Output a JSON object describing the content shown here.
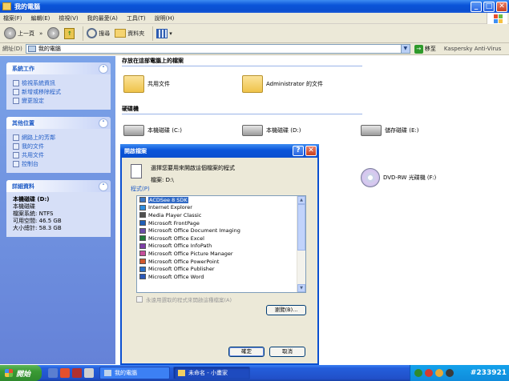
{
  "window": {
    "title": "我的電腦",
    "controls": {
      "minimize": "_",
      "maximize": "□",
      "close": "✕"
    }
  },
  "menubar": {
    "items": [
      "檔案(F)",
      "編輯(E)",
      "檢視(V)",
      "我的最愛(A)",
      "工具(T)",
      "說明(H)"
    ]
  },
  "toolbar": {
    "back": "上一頁",
    "forward": "»",
    "search": "搜尋",
    "folders": "資料夾",
    "views_arrow": "▾"
  },
  "addressbar": {
    "label": "網址(D)",
    "value": "我的電腦",
    "go_label": "移至",
    "links_label": "Kaspersky Anti-Virus"
  },
  "taskpane": {
    "system_tasks": {
      "title": "系統工作",
      "items": [
        "檢視系統資訊",
        "新增或移除程式",
        "變更設定"
      ]
    },
    "other_places": {
      "title": "其他位置",
      "items": [
        "網路上的芳鄰",
        "我的文件",
        "共用文件",
        "控制台"
      ]
    },
    "details": {
      "title": "詳細資料",
      "name": "本機磁碟 (D:)",
      "type": "本機磁碟",
      "fs": "檔案系統: NTFS",
      "free": "可用空間: 46.5 GB",
      "total": "大小總計: 58.3 GB"
    },
    "collapse_glyph": "˄"
  },
  "content": {
    "stored_files_header": "存放在這部電腦上的檔案",
    "folders": [
      "共用文件",
      "Administrator 的文件"
    ],
    "drives_header": "硬碟機",
    "drives": [
      "本機磁碟 (C:)",
      "本機磁碟 (D:)",
      "儲存磁碟 (E:)"
    ],
    "removable": [
      "DVD-RW 光碟機 (F:)"
    ]
  },
  "dialog": {
    "title": "開啟檔案",
    "help": "?",
    "close": "✕",
    "prompt": "選擇您要用來開啟這個檔案的程式",
    "file_label": "檔案:   D:\\",
    "programs_label": "程式(P)",
    "programs": [
      {
        "name": "ACDSee 8 SDK",
        "color": "#3a76c4",
        "selected": true
      },
      {
        "name": "Internet Explorer",
        "color": "#2d8ee0",
        "selected": false
      },
      {
        "name": "Media Player Classic",
        "color": "#4f4f4f",
        "selected": false
      },
      {
        "name": "Microsoft FrontPage",
        "color": "#1f5fb7",
        "selected": false
      },
      {
        "name": "Microsoft Office Document Imaging",
        "color": "#6a4ca8",
        "selected": false
      },
      {
        "name": "Microsoft Office Excel",
        "color": "#1f7a3a",
        "selected": false
      },
      {
        "name": "Microsoft Office InfoPath",
        "color": "#7f3ea8",
        "selected": false
      },
      {
        "name": "Microsoft Office Picture Manager",
        "color": "#c64e9b",
        "selected": false
      },
      {
        "name": "Microsoft Office PowerPoint",
        "color": "#d2582b",
        "selected": false
      },
      {
        "name": "Microsoft Office Publisher",
        "color": "#2a70c8",
        "selected": false
      },
      {
        "name": "Microsoft Office Word",
        "color": "#2b58b8",
        "selected": false
      }
    ],
    "always_use": "永遠用選取的程式來開啟這種檔案(A)",
    "browse": "瀏覽(B)...",
    "ok": "確定",
    "cancel": "取消"
  },
  "taskbar": {
    "start": "開始",
    "tasks": [
      "我的電腦",
      "未命名 - 小畫家"
    ],
    "watermark": "#233921"
  },
  "colors": {
    "xp_blue": "#0a54d9",
    "task_pane": "#6f8fdf",
    "start_green": "#3a9a34",
    "selection": "#316ac5"
  }
}
